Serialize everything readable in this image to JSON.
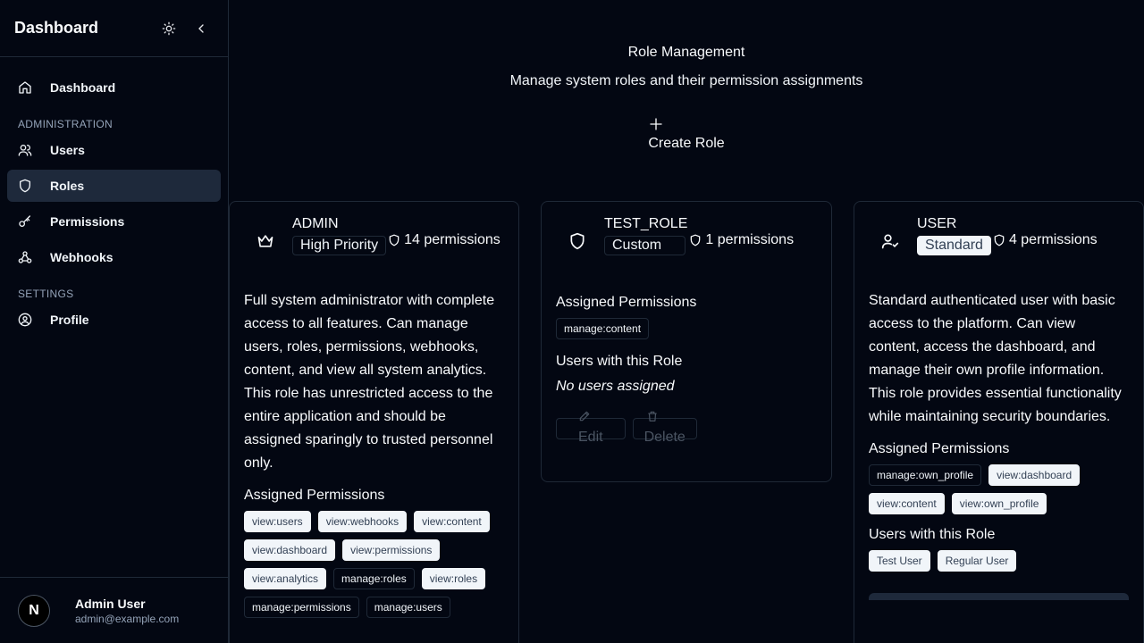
{
  "sidebar": {
    "title": "Dashboard",
    "nav": {
      "dashboard": "Dashboard",
      "section_admin": "ADMINISTRATION",
      "users": "Users",
      "roles": "Roles",
      "permissions": "Permissions",
      "webhooks": "Webhooks",
      "section_settings": "SETTINGS",
      "profile": "Profile"
    },
    "user": {
      "avatar_initial": "N",
      "name": "Admin User",
      "email": "admin@example.com"
    }
  },
  "main": {
    "title": "Role Management",
    "subtitle": "Manage system roles and their permission assignments",
    "create_label": "Create Role"
  },
  "roles": [
    {
      "name": "ADMIN",
      "badge": "High Priority",
      "permissions_count": "14 permissions",
      "description": "Full system administrator with complete access to all features. Can manage users, roles, permissions, webhooks, content, and view all system analytics. This role has unrestricted access to the entire application and should be assigned sparingly to trusted personnel only.",
      "assigned_label": "Assigned Permissions",
      "permissions": [
        "view:users",
        "view:webhooks",
        "view:content",
        "view:dashboard",
        "view:permissions",
        "view:analytics",
        "manage:roles",
        "view:roles",
        "manage:permissions",
        "manage:users"
      ]
    },
    {
      "name": "TEST_ROLE",
      "badge": "Custom",
      "permissions_count": "1 permissions",
      "assigned_label": "Assigned Permissions",
      "permissions": [
        "manage:content"
      ],
      "users_label": "Users with this Role",
      "no_users": "No users assigned",
      "edit_label": "Edit",
      "delete_label": "Delete"
    },
    {
      "name": "USER",
      "badge": "Standard",
      "permissions_count": "4 permissions",
      "description": "Standard authenticated user with basic access to the platform. Can view content, access the dashboard, and manage their own profile information. This role provides essential functionality while maintaining security boundaries.",
      "assigned_label": "Assigned Permissions",
      "permissions": [
        "manage:own_profile",
        "view:dashboard",
        "view:content",
        "view:own_profile"
      ],
      "users_label": "Users with this Role",
      "users": [
        "Test User",
        "Regular User"
      ]
    }
  ]
}
